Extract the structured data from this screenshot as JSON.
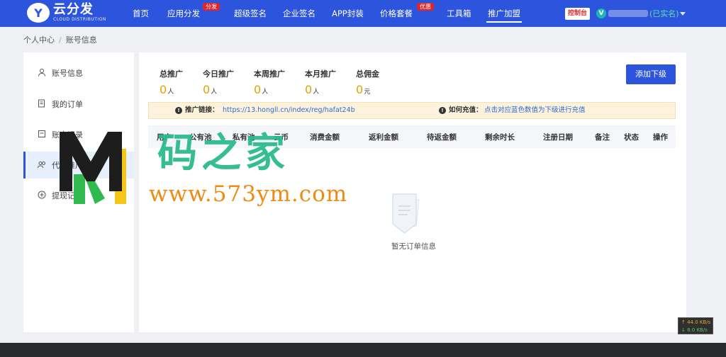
{
  "brand": {
    "mark": "Y",
    "name": "云分发",
    "subtitle": "CLOUD DISTRIBUTION",
    "color": "#2c54dc"
  },
  "nav": {
    "items": [
      {
        "label": "首页"
      },
      {
        "label": "应用分发",
        "badge": "分发"
      },
      {
        "label": "超级签名"
      },
      {
        "label": "企业签名"
      },
      {
        "label": "APP封装"
      },
      {
        "label": "价格套餐",
        "badge": "优惠"
      },
      {
        "label": "工具箱"
      },
      {
        "label": "推广加盟",
        "active": true
      }
    ],
    "console_label": "控制台",
    "user_initial": "V",
    "user_verified": "(已实名)"
  },
  "breadcrumb": {
    "root": "个人中心",
    "separator": "/",
    "current": "账号信息"
  },
  "sidebar": {
    "items": [
      {
        "label": "账号信息",
        "icon": "user-icon"
      },
      {
        "label": "我的订单",
        "icon": "order-icon"
      },
      {
        "label": "账户记录",
        "icon": "record-icon"
      },
      {
        "label": "代理推广",
        "icon": "agent-icon",
        "active": true
      },
      {
        "label": "提现记录",
        "icon": "withdraw-icon"
      }
    ]
  },
  "stats": [
    {
      "label": "总推广",
      "value": "0",
      "unit": "人"
    },
    {
      "label": "今日推广",
      "value": "0",
      "unit": "人"
    },
    {
      "label": "本周推广",
      "value": "0",
      "unit": "人"
    },
    {
      "label": "本月推广",
      "value": "0",
      "unit": "人"
    },
    {
      "label": "总佣金",
      "value": "0",
      "unit": "元"
    }
  ],
  "actions": {
    "add_sub_label": "添加下级"
  },
  "notice": {
    "link_label": "推广链接：",
    "link_value": "https://13.hongll.cn/index/reg/hafat24b",
    "recharge_label": "如何充值：",
    "recharge_value": "点击对应蓝色数值为下级进行充值"
  },
  "table": {
    "columns": [
      "用户",
      "公有池",
      "私有池",
      "云币",
      "消费金额",
      "返利金额",
      "待返金额",
      "剩余时长",
      "注册日期",
      "备注",
      "状态",
      "操作"
    ],
    "empty_text": "暂无订单信息"
  },
  "watermark": {
    "title": "码之家",
    "url": "www.573ym.com"
  },
  "speed": {
    "up": "↑ 44.0 KB/s",
    "down": "↓ 8.0 KB/s"
  }
}
